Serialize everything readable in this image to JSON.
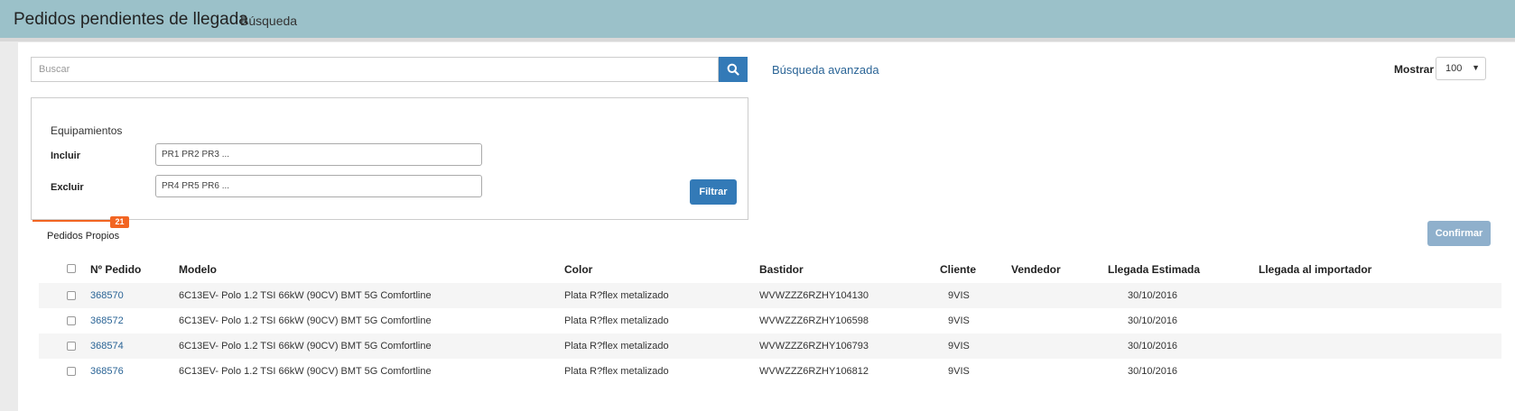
{
  "header": {
    "title": "Pedidos pendientes de llegada",
    "subtitle": "Búsqueda"
  },
  "search": {
    "placeholder": "Buscar",
    "advanced_link": "Búsqueda avanzada"
  },
  "mostrar": {
    "label": "Mostrar",
    "value": "100"
  },
  "filter": {
    "heading": "Equipamientos",
    "include_label": "Incluir",
    "include_placeholder": "PR1 PR2 PR3 ...",
    "exclude_label": "Excluir",
    "exclude_placeholder": "PR4 PR5 PR6 ...",
    "button": "Filtrar"
  },
  "tab": {
    "label": "Pedidos Propios",
    "badge": "21"
  },
  "confirm_button": "Confirmar",
  "table": {
    "columns": [
      "Nº Pedido",
      "Modelo",
      "Color",
      "Bastidor",
      "Cliente",
      "Vendedor",
      "Llegada Estimada",
      "Llegada al importador"
    ],
    "rows": [
      {
        "pedido": "368570",
        "modelo": "6C13EV- Polo 1.2 TSI 66kW (90CV) BMT 5G Comfortline",
        "color": "Plata R?flex metalizado",
        "bastidor": "WVWZZZ6RZHY104130",
        "cliente": "9VIS",
        "vendedor": "",
        "llegada_estimada": "30/10/2016",
        "llegada_importador": ""
      },
      {
        "pedido": "368572",
        "modelo": "6C13EV- Polo 1.2 TSI 66kW (90CV) BMT 5G Comfortline",
        "color": "Plata R?flex metalizado",
        "bastidor": "WVWZZZ6RZHY106598",
        "cliente": "9VIS",
        "vendedor": "",
        "llegada_estimada": "30/10/2016",
        "llegada_importador": ""
      },
      {
        "pedido": "368574",
        "modelo": "6C13EV- Polo 1.2 TSI 66kW (90CV) BMT 5G Comfortline",
        "color": "Plata R?flex metalizado",
        "bastidor": "WVWZZZ6RZHY106793",
        "cliente": "9VIS",
        "vendedor": "",
        "llegada_estimada": "30/10/2016",
        "llegada_importador": ""
      },
      {
        "pedido": "368576",
        "modelo": "6C13EV- Polo 1.2 TSI 66kW (90CV) BMT 5G Comfortline",
        "color": "Plata R?flex metalizado",
        "bastidor": "WVWZZZ6RZHY106812",
        "cliente": "9VIS",
        "vendedor": "",
        "llegada_estimada": "30/10/2016",
        "llegada_importador": ""
      }
    ]
  },
  "colors": {
    "header_bg": "#9bc1c9",
    "primary": "#337ab7",
    "accent": "#f26522"
  }
}
